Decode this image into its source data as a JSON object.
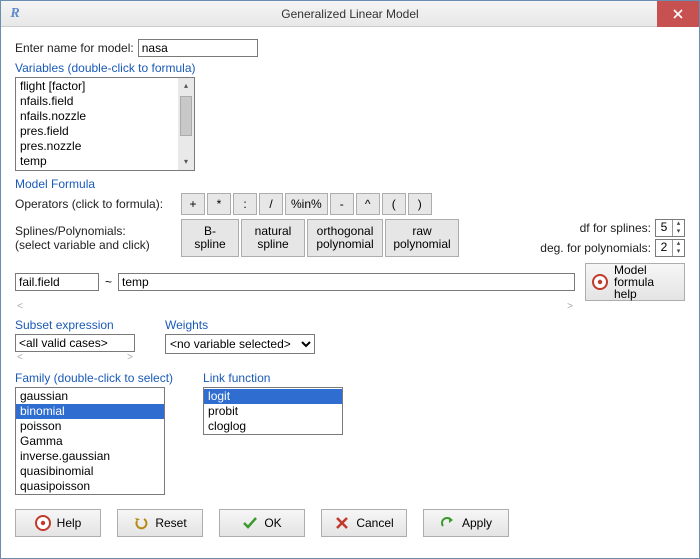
{
  "window": {
    "title": "Generalized Linear Model",
    "icon": "R"
  },
  "model": {
    "name_label": "Enter name for model:",
    "name_value": "nasa"
  },
  "variables": {
    "heading": "Variables (double-click to formula)",
    "items": [
      "flight [factor]",
      "nfails.field",
      "nfails.nozzle",
      "pres.field",
      "pres.nozzle",
      "temp"
    ]
  },
  "formula": {
    "heading": "Model Formula",
    "operators_label": "Operators (click to formula):",
    "operators": [
      "+",
      "*",
      ":",
      "/",
      "%in%",
      "-",
      "^",
      "(",
      ")"
    ],
    "splines_label1": "Splines/Polynomials:",
    "splines_label2": "(select variable and click)",
    "splines": [
      "B-spline",
      "natural\nspline",
      "orthogonal\npolynomial",
      "raw\npolynomial"
    ],
    "df_label": "df for splines:",
    "df_value": "5",
    "deg_label": "deg. for polynomials:",
    "deg_value": "2",
    "lhs": "fail.field",
    "tilde": "~",
    "rhs": "temp ",
    "help_label": "Model formula help"
  },
  "subset": {
    "heading": "Subset expression",
    "value": "<all valid cases>"
  },
  "weights": {
    "heading": "Weights",
    "selected": "<no variable selected>"
  },
  "family": {
    "heading": "Family (double-click to select)",
    "items": [
      "gaussian",
      "binomial",
      "poisson",
      "Gamma",
      "inverse.gaussian",
      "quasibinomial",
      "quasipoisson"
    ],
    "selected": "binomial"
  },
  "link": {
    "heading": "Link function",
    "items": [
      "logit",
      "probit",
      "cloglog"
    ],
    "selected": "logit"
  },
  "buttons": {
    "help": "Help",
    "reset": "Reset",
    "ok": "OK",
    "cancel": "Cancel",
    "apply": "Apply"
  }
}
